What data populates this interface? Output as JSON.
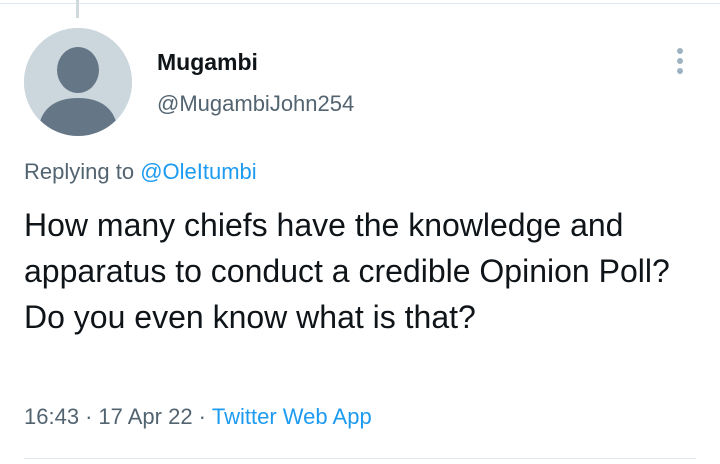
{
  "author": {
    "display_name": "Mugambi",
    "handle": "@MugambiJohn254",
    "avatar_icon": "default-profile-icon"
  },
  "reply": {
    "prefix": "Replying to",
    "mention": "@OleItumbi"
  },
  "tweet": {
    "text": "How many chiefs have the knowledge and apparatus to conduct a credible Opinion Poll? Do you even know what is that?"
  },
  "meta": {
    "time": "16:43",
    "separator": "·",
    "date": "17 Apr 22",
    "source": "Twitter Web App"
  },
  "icons": {
    "more": "more-options-icon"
  },
  "colors": {
    "link": "#1d9bf0",
    "secondary_text": "#536471",
    "primary_text": "#0f1419",
    "avatar_bg": "#ccd6dd",
    "avatar_figure": "#657786"
  }
}
